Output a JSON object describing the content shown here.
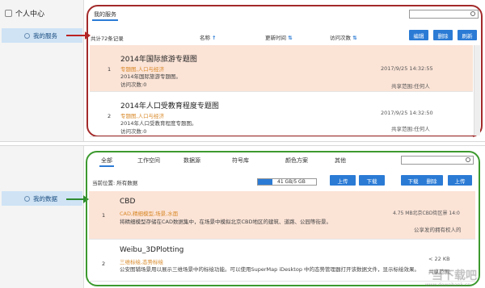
{
  "top": {
    "sidebar": {
      "header": "个人中心",
      "item": "我的服务"
    },
    "tab": "我的服务",
    "search_placeholder": "",
    "total": "共计72条记录",
    "headers": {
      "name": "名称",
      "update_time": "更新时间",
      "views": "访问次数"
    },
    "buttons": {
      "edit": "编辑",
      "delete": "删除",
      "refresh": "刷新"
    },
    "rows": [
      {
        "num": "1",
        "title": "2014年国际旅游专题图",
        "tag": "专题图,人口与经济",
        "desc": "2014年国际旅游专题图。",
        "views": "访问次数:0",
        "time": "2017/9/25 14:32:55",
        "share": "共享范围:任何人"
      },
      {
        "num": "2",
        "title": "2014年人口受教育程度专题图",
        "tag": "专题图,人口与经济",
        "desc": "2014年人口受教育程度专题图。",
        "views": "访问次数:0",
        "time": "2017/9/25 14:32:50",
        "share": "共享范围:任何人"
      }
    ]
  },
  "bottom": {
    "sidebar": {
      "item": "我的数据"
    },
    "tabs": [
      "全部",
      "工作空间",
      "数据源",
      "符号库",
      "颜色方案",
      "其他"
    ],
    "location": "当前位置: 所有数据",
    "storage": {
      "text": "41 GB/5 GB",
      "fraction": 0.25
    },
    "buttons": {
      "upload": "上传",
      "download": "下载",
      "download2": "下载",
      "delete": "删除",
      "upload2": "上传"
    },
    "rows": [
      {
        "num": "1",
        "title": "CBD",
        "tag": "CAD,精细模型,场景,水面",
        "desc": "将精细模型存储在CAD数据集中，在场景中模拟北京CBD地区的建筑、道路、公园等街景。",
        "meta": "4.75 MB北京CBD街区景 14:0",
        "share": "公享发的拥有权人的"
      },
      {
        "num": "2",
        "title": "Weibu_3DPlotting",
        "tag": "三维标绘,态势标绘",
        "desc": "公安图辅场景用以展示三维场景中的标绘功能。可以使用SuperMap iDesktop 中的态势管理器打开该数据文件，显示标绘效果。",
        "meta": "< 22 KB",
        "share": "共享范围:"
      }
    ]
  },
  "watermark": {
    "main": "当下载吧",
    "sub": "www.downbank.cn"
  }
}
